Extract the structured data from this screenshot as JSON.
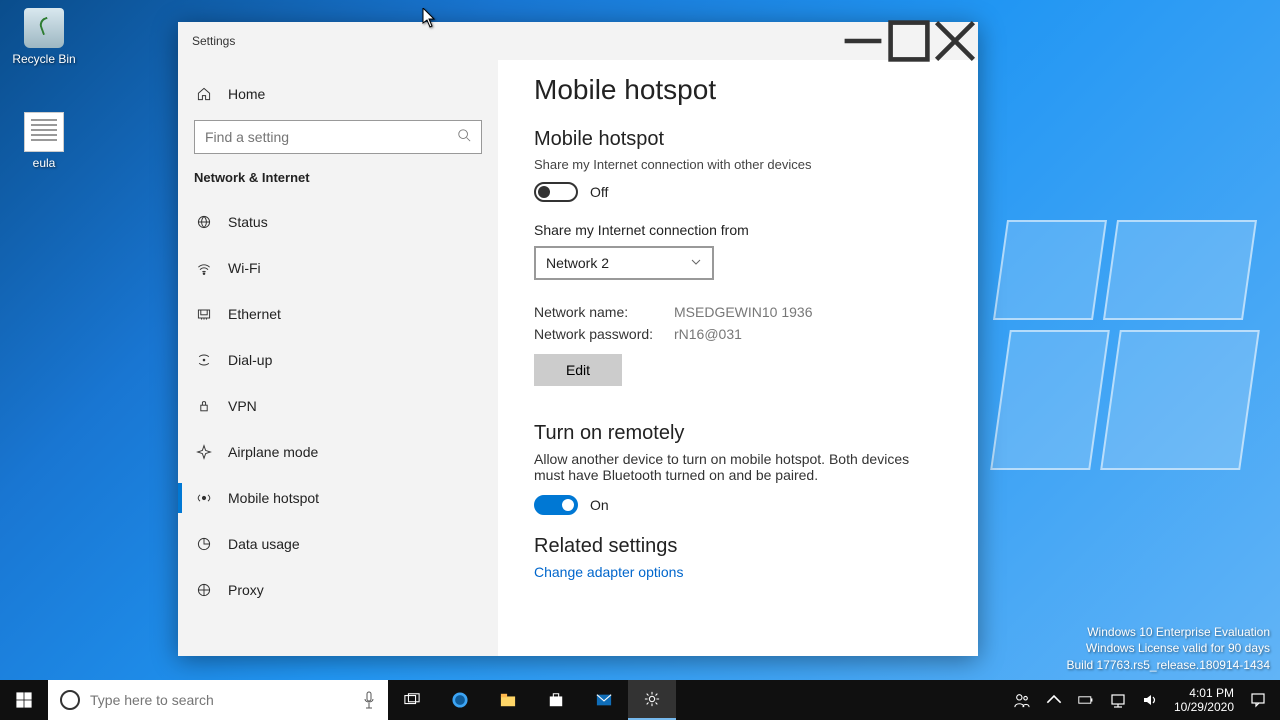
{
  "desktop": {
    "icons": [
      {
        "label": "Recycle Bin"
      },
      {
        "label": "eula"
      }
    ]
  },
  "window": {
    "title": "Settings",
    "sidebar": {
      "home": "Home",
      "search_placeholder": "Find a setting",
      "category": "Network & Internet",
      "items": [
        {
          "label": "Status",
          "icon": "globe-icon"
        },
        {
          "label": "Wi-Fi",
          "icon": "wifi-icon"
        },
        {
          "label": "Ethernet",
          "icon": "ethernet-icon"
        },
        {
          "label": "Dial-up",
          "icon": "dialup-icon"
        },
        {
          "label": "VPN",
          "icon": "vpn-icon"
        },
        {
          "label": "Airplane mode",
          "icon": "airplane-icon"
        },
        {
          "label": "Mobile hotspot",
          "icon": "hotspot-icon",
          "active": true
        },
        {
          "label": "Data usage",
          "icon": "data-icon"
        },
        {
          "label": "Proxy",
          "icon": "proxy-icon"
        }
      ]
    },
    "content": {
      "page_title": "Mobile hotspot",
      "share_heading": "Mobile hotspot",
      "share_sub": "Share my Internet connection with other devices",
      "share_toggle_state": "Off",
      "from_label": "Share my Internet connection from",
      "from_value": "Network 2",
      "net_name_label": "Network name:",
      "net_name_value": "MSEDGEWIN10 1936",
      "net_pass_label": "Network password:",
      "net_pass_value": "rN16@031",
      "edit_label": "Edit",
      "remote_heading": "Turn on remotely",
      "remote_desc": "Allow another device to turn on mobile hotspot. Both devices must have Bluetooth turned on and be paired.",
      "remote_toggle_state": "On",
      "related_heading": "Related settings",
      "related_link": "Change adapter options"
    }
  },
  "watermark": {
    "line1": "Windows 10 Enterprise Evaluation",
    "line2": "Windows License valid for 90 days",
    "line3": "Build 17763.rs5_release.180914-1434"
  },
  "taskbar": {
    "search_placeholder": "Type here to search",
    "clock_time": "4:01 PM",
    "clock_date": "10/29/2020"
  }
}
